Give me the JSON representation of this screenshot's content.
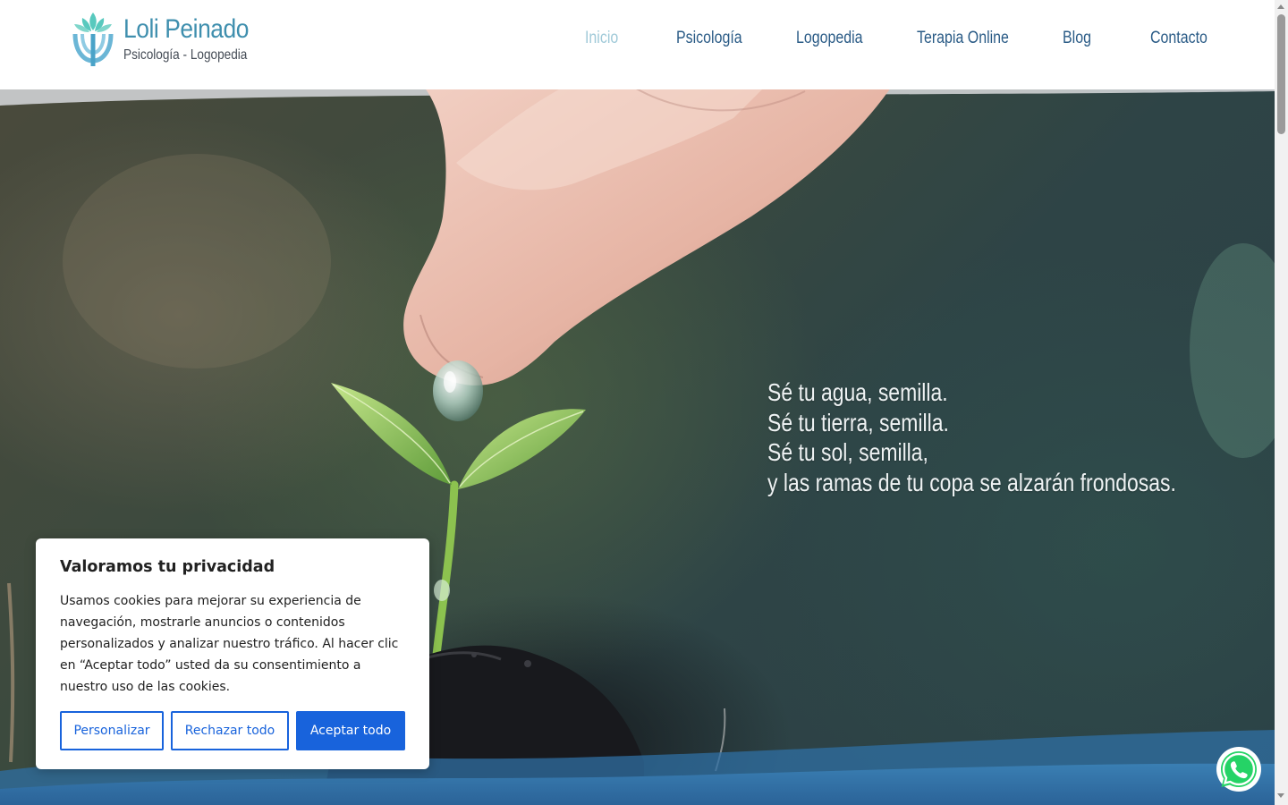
{
  "header": {
    "logo_name": "Loli Peinado",
    "logo_tagline": "Psicología - Logopedia",
    "nav": [
      {
        "label": "Inicio",
        "active": true
      },
      {
        "label": "Psicología",
        "active": false
      },
      {
        "label": "Logopedia",
        "active": false
      },
      {
        "label": "Terapia Online",
        "active": false
      },
      {
        "label": "Blog",
        "active": false
      },
      {
        "label": "Contacto",
        "active": false
      }
    ]
  },
  "hero": {
    "quote_lines": [
      "Sé tu agua, semilla.",
      "Sé tu tierra, semilla.",
      "Sé tu sol, semilla,",
      "y las ramas de tu copa se alzarán frondosas."
    ],
    "image_icon": "hand-watering-seedling-photo"
  },
  "cookie_banner": {
    "title": "Valoramos tu privacidad",
    "text": "Usamos cookies para mejorar su experiencia de navegación, mostrarle anuncios o contenidos personalizados y analizar nuestro tráfico. Al hacer clic en “Aceptar todo” usted da su consentimiento a nuestro uso de las cookies.",
    "buttons": {
      "customize": "Personalizar",
      "reject": "Rechazar todo",
      "accept": "Aceptar todo"
    }
  },
  "floating": {
    "whatsapp_icon": "whatsapp-icon"
  },
  "colors": {
    "brand_teal": "#3f8fae",
    "nav_blue": "#2a5b86",
    "nav_active": "#9fc9d8",
    "wave_blue": "#2f6fa3",
    "cookie_blue": "#1863dc",
    "whatsapp_green": "#25d366"
  }
}
